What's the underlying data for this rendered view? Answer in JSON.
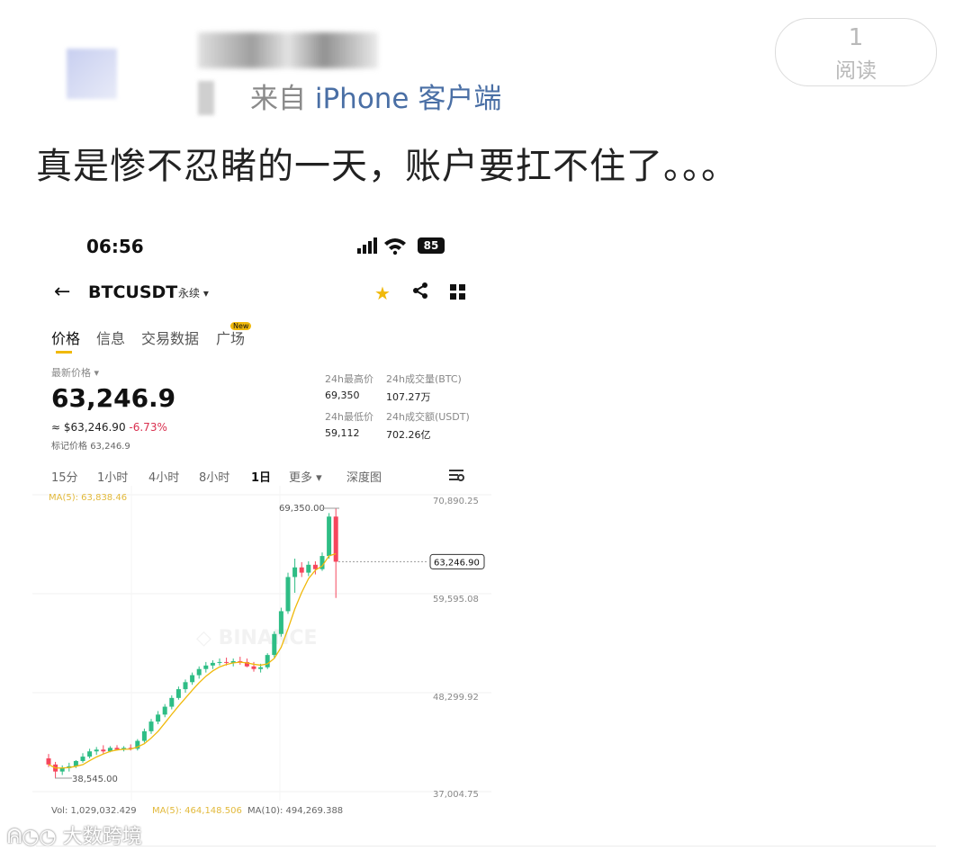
{
  "post": {
    "source_prefix": "来自",
    "source_brand": "iPhone 客户端",
    "read_count": "1",
    "read_label": "阅读",
    "text": "真是惨不忍睹的一天，账户要扛不住了。。。"
  },
  "phone": {
    "status": {
      "time": "06:56",
      "battery": "85"
    },
    "header": {
      "back_icon": "arrow-left-icon",
      "pair": "BTCUSDT",
      "contract": "永续"
    },
    "tabs": [
      {
        "label": "价格",
        "active": true
      },
      {
        "label": "信息"
      },
      {
        "label": "交易数据"
      },
      {
        "label": "广场",
        "badge": "New"
      }
    ],
    "ticker": {
      "last_price_label": "最新价格",
      "last_price": "63,246.9",
      "usd_value": "≈ $63,246.90",
      "change": "-6.73%",
      "mark_label": "标记价格",
      "mark_price": "63,246.9",
      "high_label": "24h最高价",
      "high": "69,350",
      "low_label": "24h最低价",
      "low": "59,112",
      "vol_btc_label": "24h成交量(BTC)",
      "vol_btc": "107.27万",
      "vol_usdt_label": "24h成交额(USDT)",
      "vol_usdt": "702.26亿"
    },
    "timeframes": [
      "15分",
      "1小时",
      "4小时",
      "8小时",
      "1日",
      "更多 ▾",
      "深度图"
    ],
    "active_timeframe": "1日",
    "ma_top": "MA(5): 63,838.46",
    "axis_labels": [
      "70,890.25",
      "59,595.08",
      "48,299.92",
      "37,004.75"
    ],
    "current_price_label": "63,246.90",
    "high_marker": "69,350.00",
    "low_marker": "38,545.00",
    "watermark": "BINANCE",
    "volume_line": {
      "vol": "Vol: 1,029,032.429",
      "ma5": "MA(5): 464,148.506",
      "ma10": "MA(10): 494,269.388"
    }
  },
  "footer": {
    "watermark": "大数跨境"
  },
  "colors": {
    "up": "#2ebd85",
    "down": "#f6465d",
    "ma": "#f0b90b",
    "accent": "#f0b90b"
  },
  "chart_data": {
    "type": "candlestick",
    "ylim": [
      37004.75,
      70890.25
    ],
    "candles": [
      {
        "o": 40800,
        "h": 41300,
        "l": 39800,
        "c": 40100
      },
      {
        "o": 40100,
        "h": 40400,
        "l": 38545,
        "c": 39300
      },
      {
        "o": 39300,
        "h": 40000,
        "l": 38900,
        "c": 39700
      },
      {
        "o": 39700,
        "h": 40300,
        "l": 39300,
        "c": 39900
      },
      {
        "o": 39900,
        "h": 40600,
        "l": 39700,
        "c": 40500
      },
      {
        "o": 40500,
        "h": 41400,
        "l": 40300,
        "c": 41000
      },
      {
        "o": 41000,
        "h": 41900,
        "l": 40800,
        "c": 41600
      },
      {
        "o": 41600,
        "h": 42100,
        "l": 41200,
        "c": 41800
      },
      {
        "o": 41800,
        "h": 42300,
        "l": 41300,
        "c": 41600
      },
      {
        "o": 41600,
        "h": 42200,
        "l": 41500,
        "c": 42000
      },
      {
        "o": 42000,
        "h": 42300,
        "l": 41700,
        "c": 41800
      },
      {
        "o": 41800,
        "h": 42200,
        "l": 41600,
        "c": 42000
      },
      {
        "o": 42000,
        "h": 42400,
        "l": 41700,
        "c": 41900
      },
      {
        "o": 41900,
        "h": 43000,
        "l": 41700,
        "c": 42800
      },
      {
        "o": 42800,
        "h": 44200,
        "l": 42600,
        "c": 43900
      },
      {
        "o": 43900,
        "h": 45300,
        "l": 43600,
        "c": 45000
      },
      {
        "o": 45000,
        "h": 46200,
        "l": 44700,
        "c": 45800
      },
      {
        "o": 45800,
        "h": 47000,
        "l": 45500,
        "c": 46700
      },
      {
        "o": 46700,
        "h": 48000,
        "l": 46400,
        "c": 47700
      },
      {
        "o": 47700,
        "h": 49000,
        "l": 47500,
        "c": 48700
      },
      {
        "o": 48700,
        "h": 49800,
        "l": 48300,
        "c": 49500
      },
      {
        "o": 49500,
        "h": 50600,
        "l": 49200,
        "c": 50300
      },
      {
        "o": 50300,
        "h": 51300,
        "l": 49900,
        "c": 51000
      },
      {
        "o": 51000,
        "h": 51800,
        "l": 50600,
        "c": 51400
      },
      {
        "o": 51400,
        "h": 52000,
        "l": 51000,
        "c": 51700
      },
      {
        "o": 51700,
        "h": 52200,
        "l": 51400,
        "c": 51800
      },
      {
        "o": 51800,
        "h": 52300,
        "l": 51400,
        "c": 51700
      },
      {
        "o": 51700,
        "h": 52200,
        "l": 51300,
        "c": 51900
      },
      {
        "o": 51900,
        "h": 52400,
        "l": 51500,
        "c": 51800
      },
      {
        "o": 51800,
        "h": 52200,
        "l": 51200,
        "c": 51300
      },
      {
        "o": 51300,
        "h": 51800,
        "l": 50700,
        "c": 51000
      },
      {
        "o": 51000,
        "h": 51600,
        "l": 50600,
        "c": 51200
      },
      {
        "o": 51200,
        "h": 52800,
        "l": 51000,
        "c": 52600
      },
      {
        "o": 52600,
        "h": 55300,
        "l": 52300,
        "c": 55000
      },
      {
        "o": 55000,
        "h": 58000,
        "l": 54700,
        "c": 57600
      },
      {
        "o": 57600,
        "h": 62000,
        "l": 57300,
        "c": 61500
      },
      {
        "o": 61500,
        "h": 63600,
        "l": 59700,
        "c": 62600
      },
      {
        "o": 62600,
        "h": 63200,
        "l": 61500,
        "c": 62000
      },
      {
        "o": 62000,
        "h": 63300,
        "l": 61600,
        "c": 62900
      },
      {
        "o": 62900,
        "h": 63300,
        "l": 61800,
        "c": 62400
      },
      {
        "o": 62400,
        "h": 64300,
        "l": 62200,
        "c": 63900
      },
      {
        "o": 63900,
        "h": 68800,
        "l": 63600,
        "c": 68400
      },
      {
        "o": 68400,
        "h": 69350,
        "l": 59112,
        "c": 63246.9
      }
    ]
  }
}
